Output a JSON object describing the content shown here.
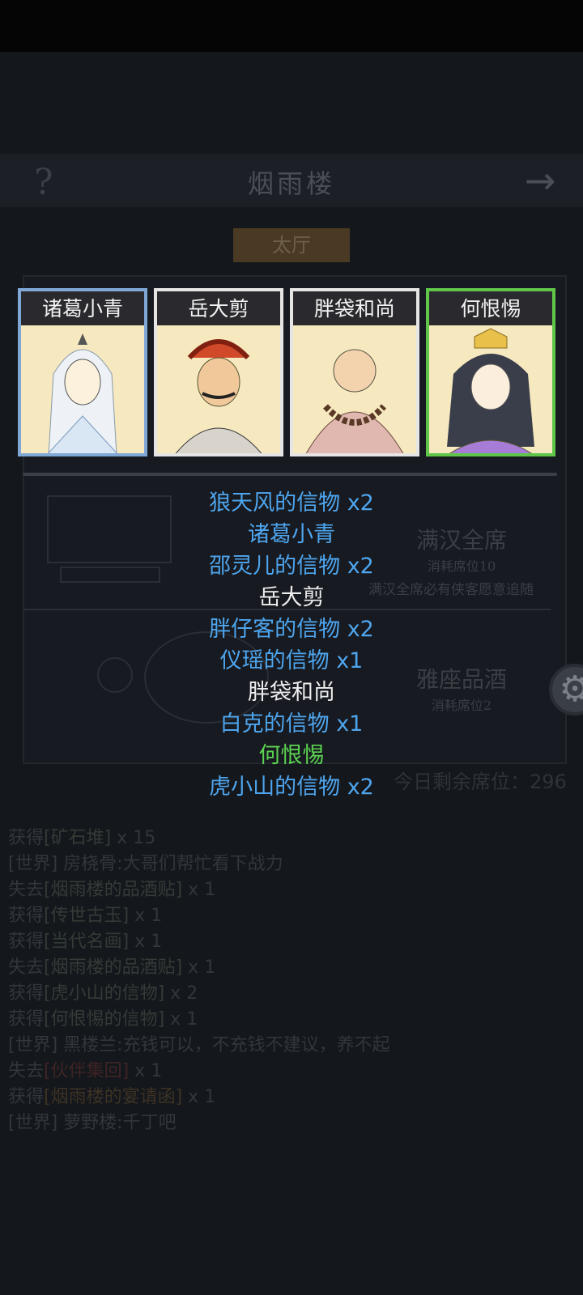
{
  "header": {
    "help_icon": "?",
    "title": "烟雨楼",
    "arrow_icon": "→",
    "tab": "太厅"
  },
  "side_options": [
    {
      "title": "满汉全席",
      "cost": "消耗席位10",
      "desc": "满汉全席必有侠客愿意追随"
    },
    {
      "title": "雅座品酒",
      "cost": "消耗席位2"
    }
  ],
  "remaining_seats": "今日剩余席位：296",
  "cards": [
    {
      "name": "诸葛小青",
      "rarity": "blue"
    },
    {
      "name": "岳大剪",
      "rarity": "white"
    },
    {
      "name": "胖袋和尚",
      "rarity": "white"
    },
    {
      "name": "何恨惕",
      "rarity": "green"
    }
  ],
  "rewards": [
    {
      "text": "狼天风的信物 x2",
      "color": "blue"
    },
    {
      "text": "诸葛小青",
      "color": "blue"
    },
    {
      "text": "邵灵儿的信物 x2",
      "color": "blue"
    },
    {
      "text": "岳大剪",
      "color": "white"
    },
    {
      "text": "胖仔客的信物 x2",
      "color": "blue"
    },
    {
      "text": "仪瑶的信物 x1",
      "color": "blue"
    },
    {
      "text": "胖袋和尚",
      "color": "white"
    },
    {
      "text": "白克的信物 x1",
      "color": "blue"
    },
    {
      "text": "何恨惕",
      "color": "green"
    },
    {
      "text": "虎小山的信物 x2",
      "color": "blue"
    }
  ],
  "log": [
    {
      "prefix": "获得",
      "item": "[矿石堆]",
      "suffix": " x 15",
      "tone": "it"
    },
    {
      "prefix": "[世界] 房桡骨:大哥们帮忙看下战力",
      "item": "",
      "suffix": "",
      "tone": "it"
    },
    {
      "prefix": "失去",
      "item": "[烟雨楼的品酒贴]",
      "suffix": " x 1",
      "tone": "it"
    },
    {
      "prefix": "获得",
      "item": "[传世古玉]",
      "suffix": " x 1",
      "tone": "it"
    },
    {
      "prefix": "获得",
      "item": "[当代名画]",
      "suffix": " x 1",
      "tone": "it"
    },
    {
      "prefix": "失去",
      "item": "[烟雨楼的品酒贴]",
      "suffix": " x 1",
      "tone": "it"
    },
    {
      "prefix": "获得",
      "item": "[虎小山的信物]",
      "suffix": " x 2",
      "tone": "it"
    },
    {
      "prefix": "获得",
      "item": "[何恨惕的信物]",
      "suffix": " x 1",
      "tone": "it"
    },
    {
      "prefix": "[世界] 黑楼兰:充钱可以，不充钱不建议，养不起",
      "item": "",
      "suffix": "",
      "tone": "it"
    },
    {
      "prefix": "失去",
      "item": "[伙伴集回]",
      "suffix": " x 1",
      "tone": "red"
    },
    {
      "prefix": "获得",
      "item": "[烟雨楼的宴请函]",
      "suffix": " x 1",
      "tone": "ora"
    },
    {
      "prefix": "[世界] 萝野楼:千丁吧",
      "item": "",
      "suffix": "",
      "tone": "it"
    }
  ]
}
